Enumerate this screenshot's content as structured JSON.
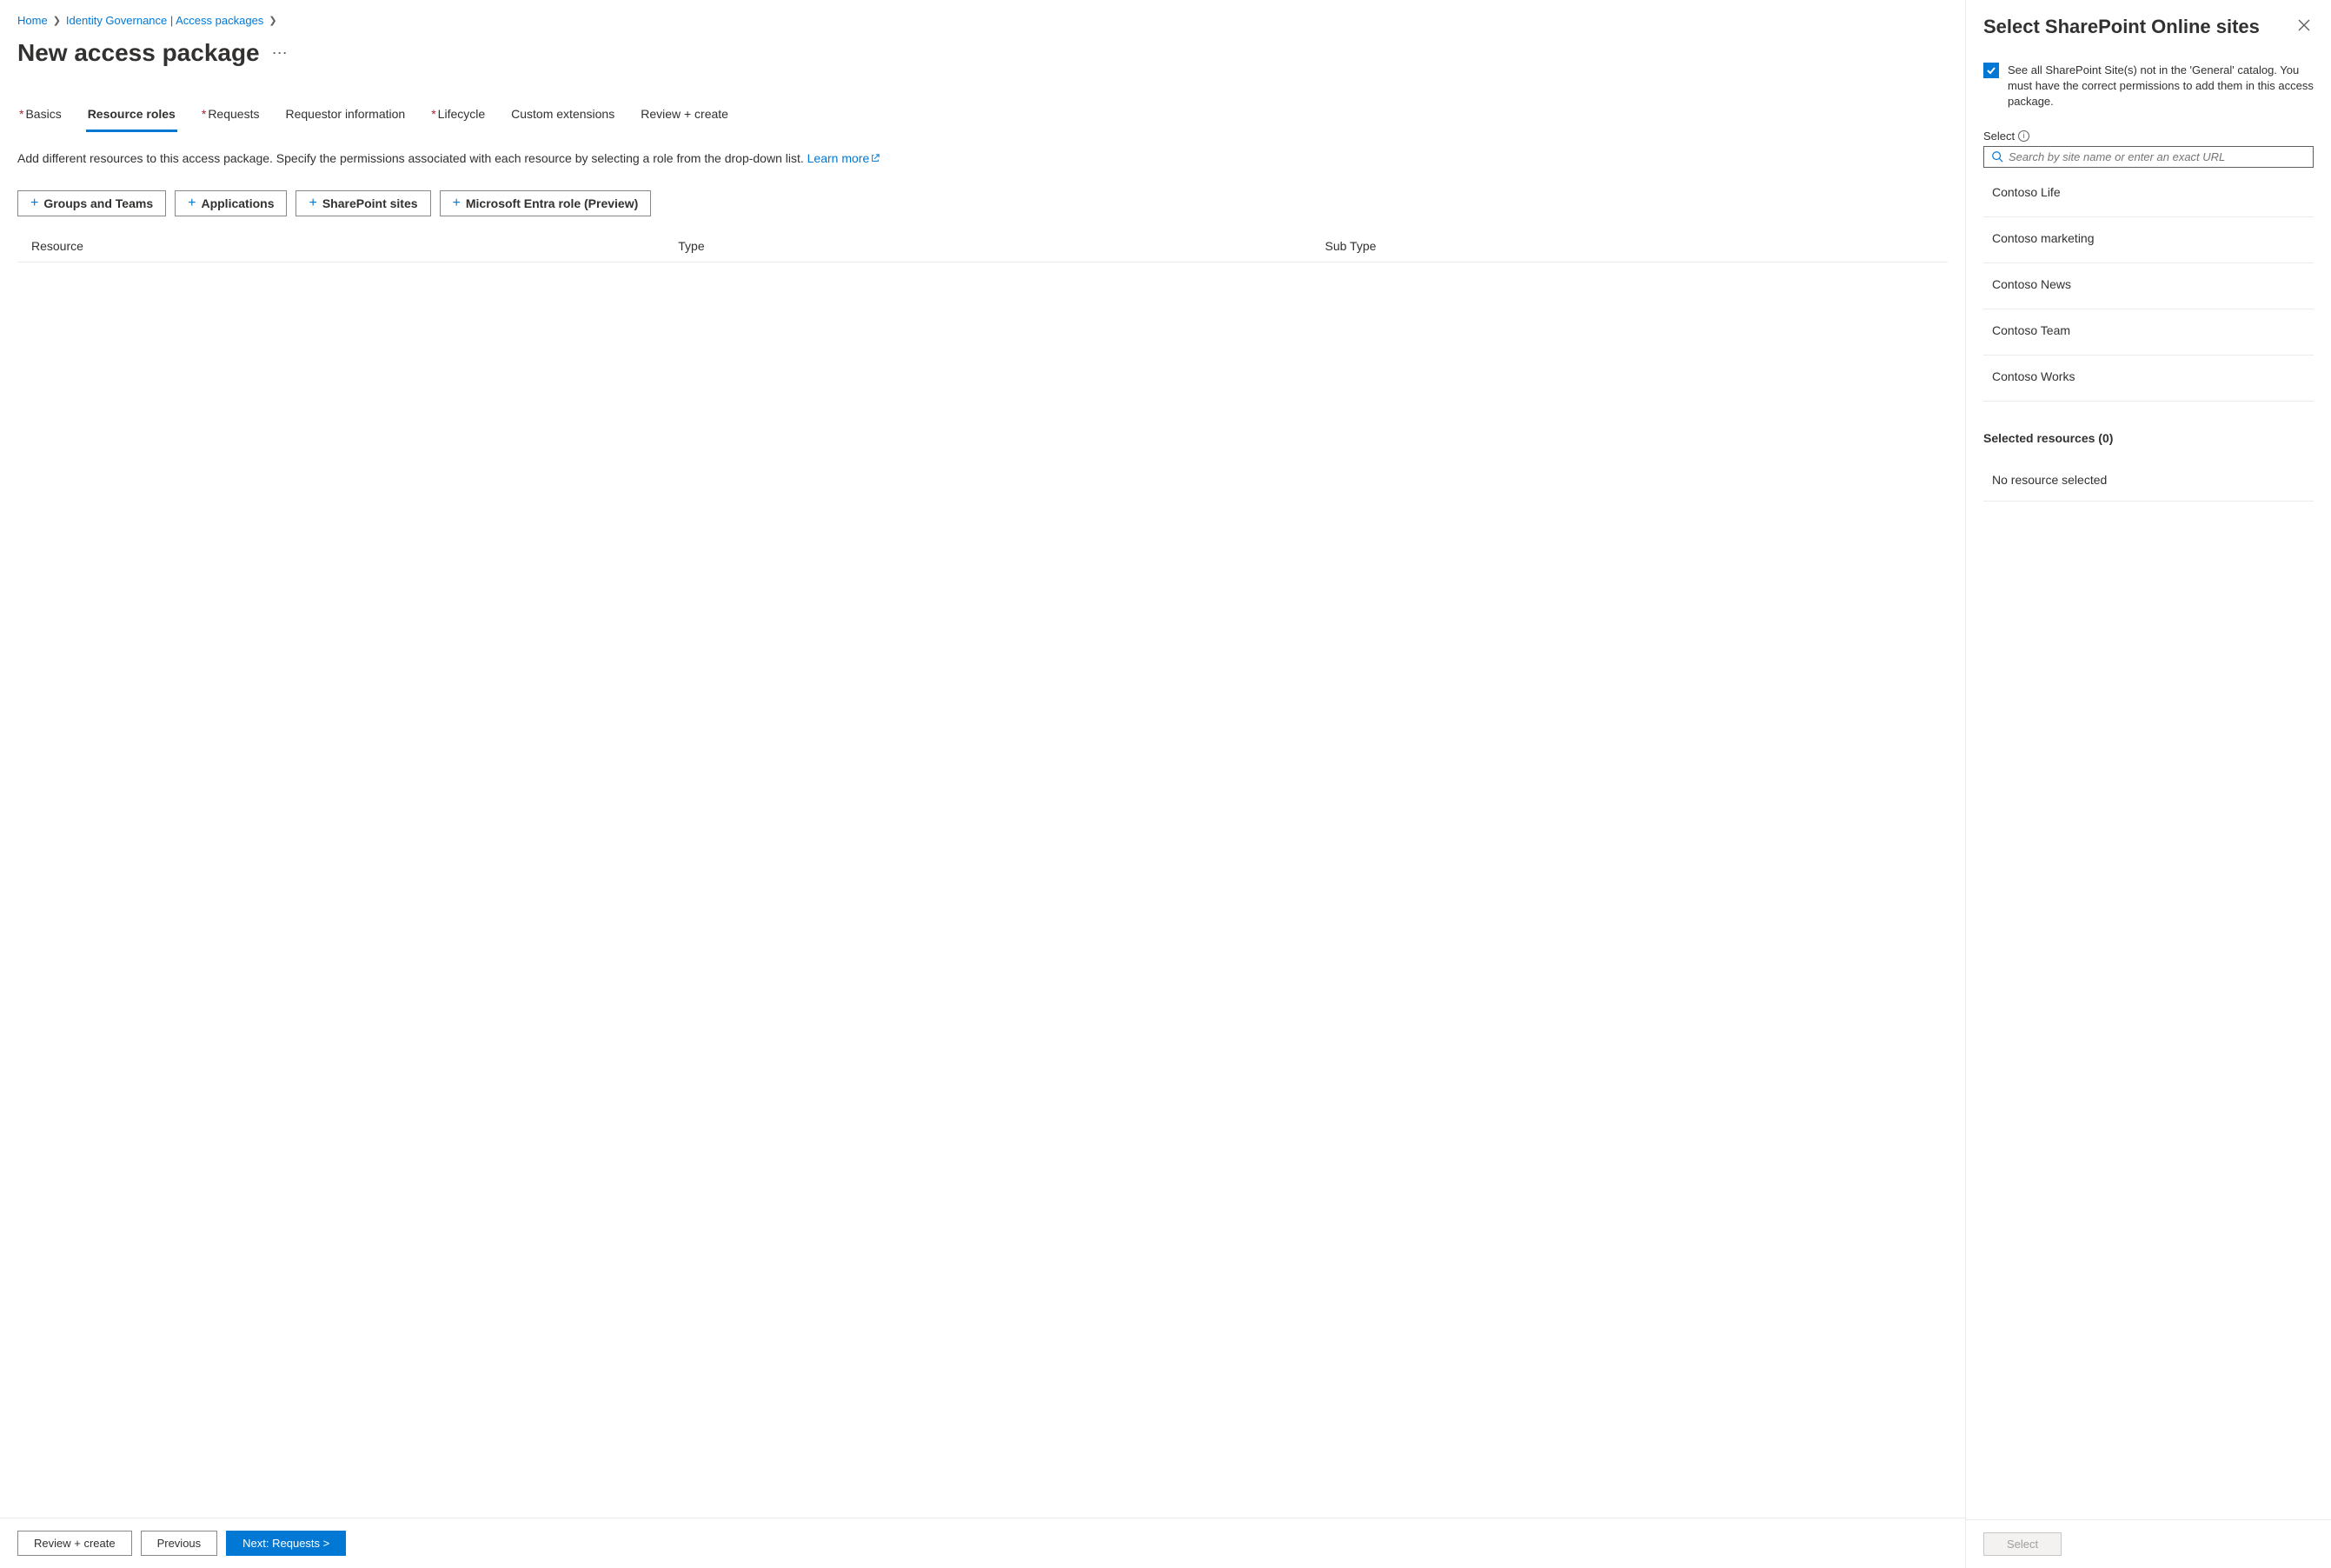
{
  "breadcrumb": {
    "home": "Home",
    "identity": "Identity Governance | Access packages"
  },
  "page": {
    "title": "New access package"
  },
  "tabs": {
    "basics": "Basics",
    "roles": "Resource roles",
    "requests": "Requests",
    "requestor": "Requestor information",
    "lifecycle": "Lifecycle",
    "custom": "Custom extensions",
    "review": "Review + create"
  },
  "desc": {
    "text": "Add different resources to this access package. Specify the permissions associated with each resource by selecting a role from the drop-down list. ",
    "link": "Learn more"
  },
  "res_buttons": {
    "groups": "Groups and Teams",
    "apps": "Applications",
    "sp": "SharePoint sites",
    "entra": "Microsoft Entra role (Preview)"
  },
  "table": {
    "resource": "Resource",
    "type": "Type",
    "subtype": "Sub Type"
  },
  "footer": {
    "review": "Review + create",
    "prev": "Previous",
    "next": "Next: Requests >"
  },
  "panel": {
    "title": "Select SharePoint Online sites",
    "checkbox_text": "See all SharePoint Site(s) not in the 'General' catalog. You must have the correct permissions to add them in this access package.",
    "select_label": "Select",
    "search_placeholder": "Search by site name or enter an exact URL",
    "sites": [
      "Contoso Life",
      "Contoso marketing",
      "Contoso News",
      "Contoso Team",
      "Contoso Works"
    ],
    "selected_heading": "Selected resources (0)",
    "no_selected": "No resource selected",
    "select_btn": "Select"
  }
}
